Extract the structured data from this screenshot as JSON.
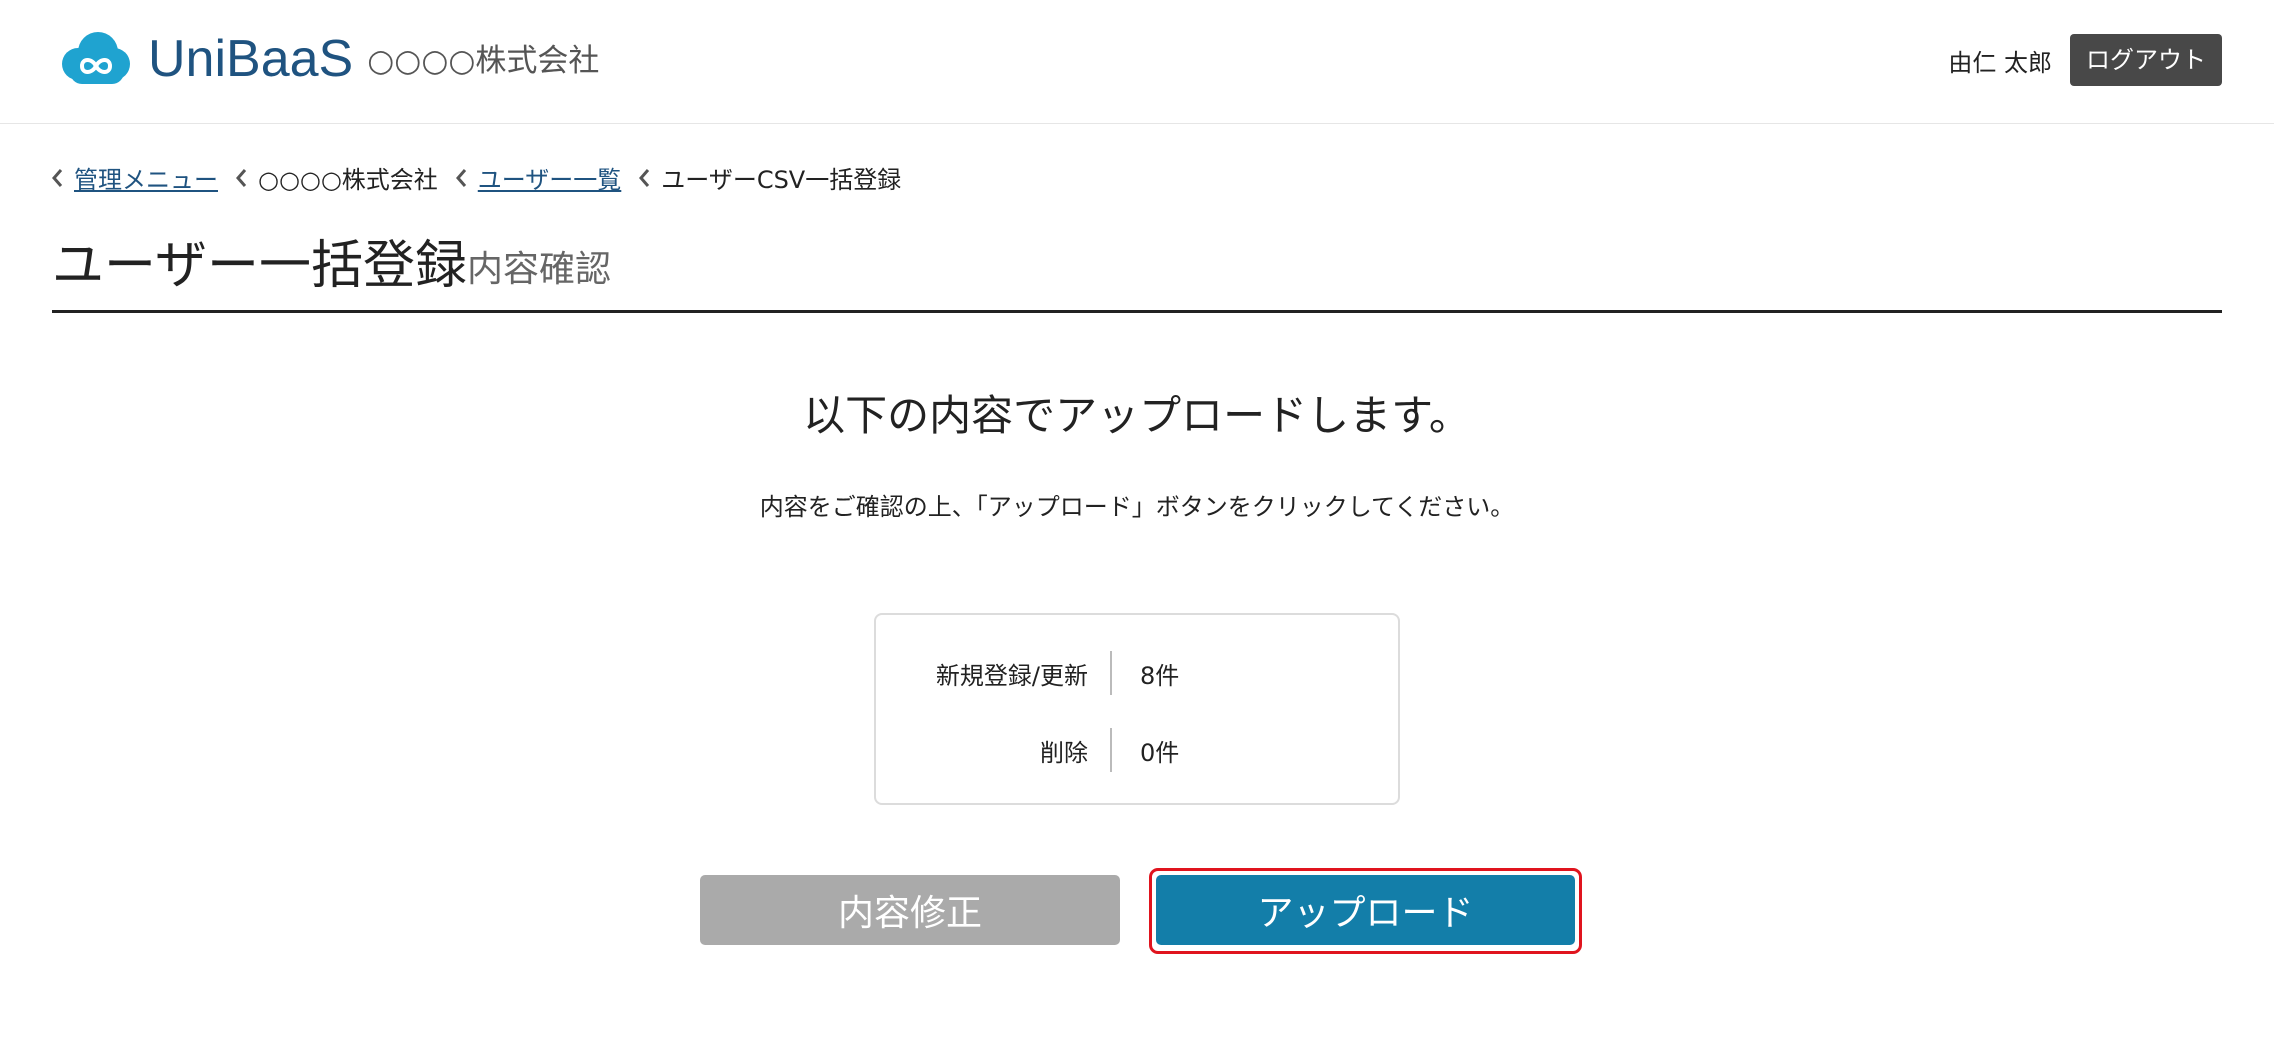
{
  "header": {
    "brand": "UniBaaS",
    "company": "○○○○株式会社",
    "user_name": "由仁 太郎",
    "logout_label": "ログアウト"
  },
  "breadcrumb": [
    {
      "label": "管理メニュー",
      "link": true
    },
    {
      "label": "○○○○株式会社",
      "link": false
    },
    {
      "label": "ユーザー一覧",
      "link": true
    },
    {
      "label": "ユーザーCSV一括登録",
      "link": false
    }
  ],
  "page": {
    "title": "ユーザー一括登録",
    "subtitle": "内容確認"
  },
  "main": {
    "lead": "以下の内容でアップロードします。",
    "note": "内容をご確認の上、「アップロード」ボタンをクリックしてください。"
  },
  "summary": [
    {
      "label": "新規登録/更新",
      "value": "8件"
    },
    {
      "label": "削除",
      "value": "0件"
    }
  ],
  "actions": {
    "edit_label": "内容修正",
    "upload_label": "アップロード"
  },
  "colors": {
    "brand": "#1f5380",
    "logo_cloud": "#1fa3d0",
    "upload_button": "#137ea9",
    "edit_button": "#aaaaaa",
    "focus_outline": "#e0141e"
  }
}
